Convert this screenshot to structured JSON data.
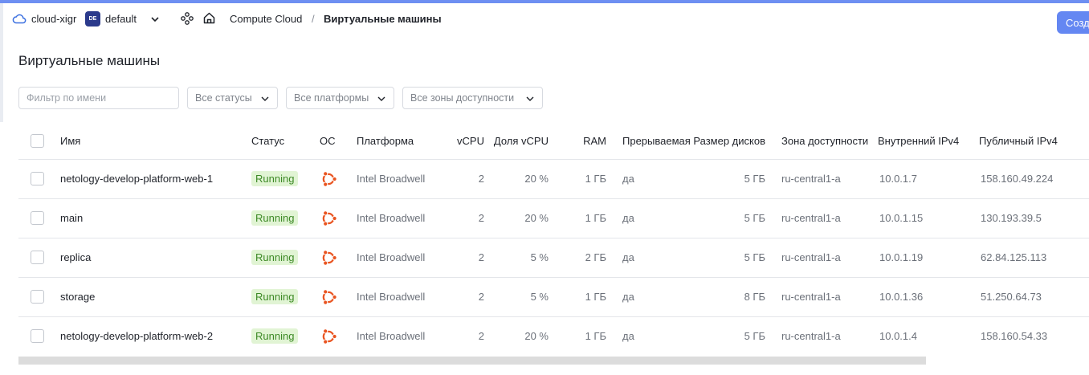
{
  "header": {
    "cloud_name": "cloud-xigr",
    "folder_badge": "DE",
    "folder_name": "default",
    "breadcrumb_service": "Compute Cloud",
    "breadcrumb_separator": "/",
    "breadcrumb_current": "Виртуальные машины",
    "create_button": "Созд"
  },
  "page": {
    "title": "Виртуальные машины"
  },
  "filters": {
    "name_placeholder": "Фильтр по имени",
    "status_select": "Все статусы",
    "platform_select": "Все платформы",
    "zone_select": "Все зоны доступности"
  },
  "table": {
    "columns": {
      "name": "Имя",
      "status": "Статус",
      "os": "ОС",
      "platform": "Платформа",
      "vcpu": "vCPU",
      "vcpu_share": "Доля vCPU",
      "ram": "RAM",
      "preemptible": "Прерываемая",
      "disk_size": "Размер дисков",
      "zone": "Зона доступности",
      "internal_ip": "Внутренний IPv4",
      "public_ip": "Публичный IPv4"
    },
    "rows": [
      {
        "name": "netology-develop-platform-web-1",
        "status": "Running",
        "os_icon": "ubuntu-icon",
        "platform": "Intel Broadwell",
        "vcpu": "2",
        "vcpu_share": "20 %",
        "ram": "1 ГБ",
        "preemptible": "да",
        "disk_size": "5 ГБ",
        "zone": "ru-central1-a",
        "internal_ip": "10.0.1.7",
        "public_ip": "158.160.49.224"
      },
      {
        "name": "main",
        "status": "Running",
        "os_icon": "ubuntu-icon",
        "platform": "Intel Broadwell",
        "vcpu": "2",
        "vcpu_share": "20 %",
        "ram": "1 ГБ",
        "preemptible": "да",
        "disk_size": "5 ГБ",
        "zone": "ru-central1-a",
        "internal_ip": "10.0.1.15",
        "public_ip": "130.193.39.5"
      },
      {
        "name": "replica",
        "status": "Running",
        "os_icon": "ubuntu-icon",
        "platform": "Intel Broadwell",
        "vcpu": "2",
        "vcpu_share": "5 %",
        "ram": "2 ГБ",
        "preemptible": "да",
        "disk_size": "5 ГБ",
        "zone": "ru-central1-a",
        "internal_ip": "10.0.1.19",
        "public_ip": "62.84.125.113"
      },
      {
        "name": "storage",
        "status": "Running",
        "os_icon": "ubuntu-icon",
        "platform": "Intel Broadwell",
        "vcpu": "2",
        "vcpu_share": "5 %",
        "ram": "1 ГБ",
        "preemptible": "да",
        "disk_size": "8 ГБ",
        "zone": "ru-central1-a",
        "internal_ip": "10.0.1.36",
        "public_ip": "51.250.64.73"
      },
      {
        "name": "netology-develop-platform-web-2",
        "status": "Running",
        "os_icon": "ubuntu-icon",
        "platform": "Intel Broadwell",
        "vcpu": "2",
        "vcpu_share": "20 %",
        "ram": "1 ГБ",
        "preemptible": "да",
        "disk_size": "5 ГБ",
        "zone": "ru-central1-a",
        "internal_ip": "10.0.1.4",
        "public_ip": "158.160.54.33"
      }
    ]
  },
  "colors": {
    "accent": "#6487f2",
    "status_running_bg": "#e1f4d4",
    "status_running_text": "#3d8a26",
    "ubuntu_orange": "#e95420"
  }
}
